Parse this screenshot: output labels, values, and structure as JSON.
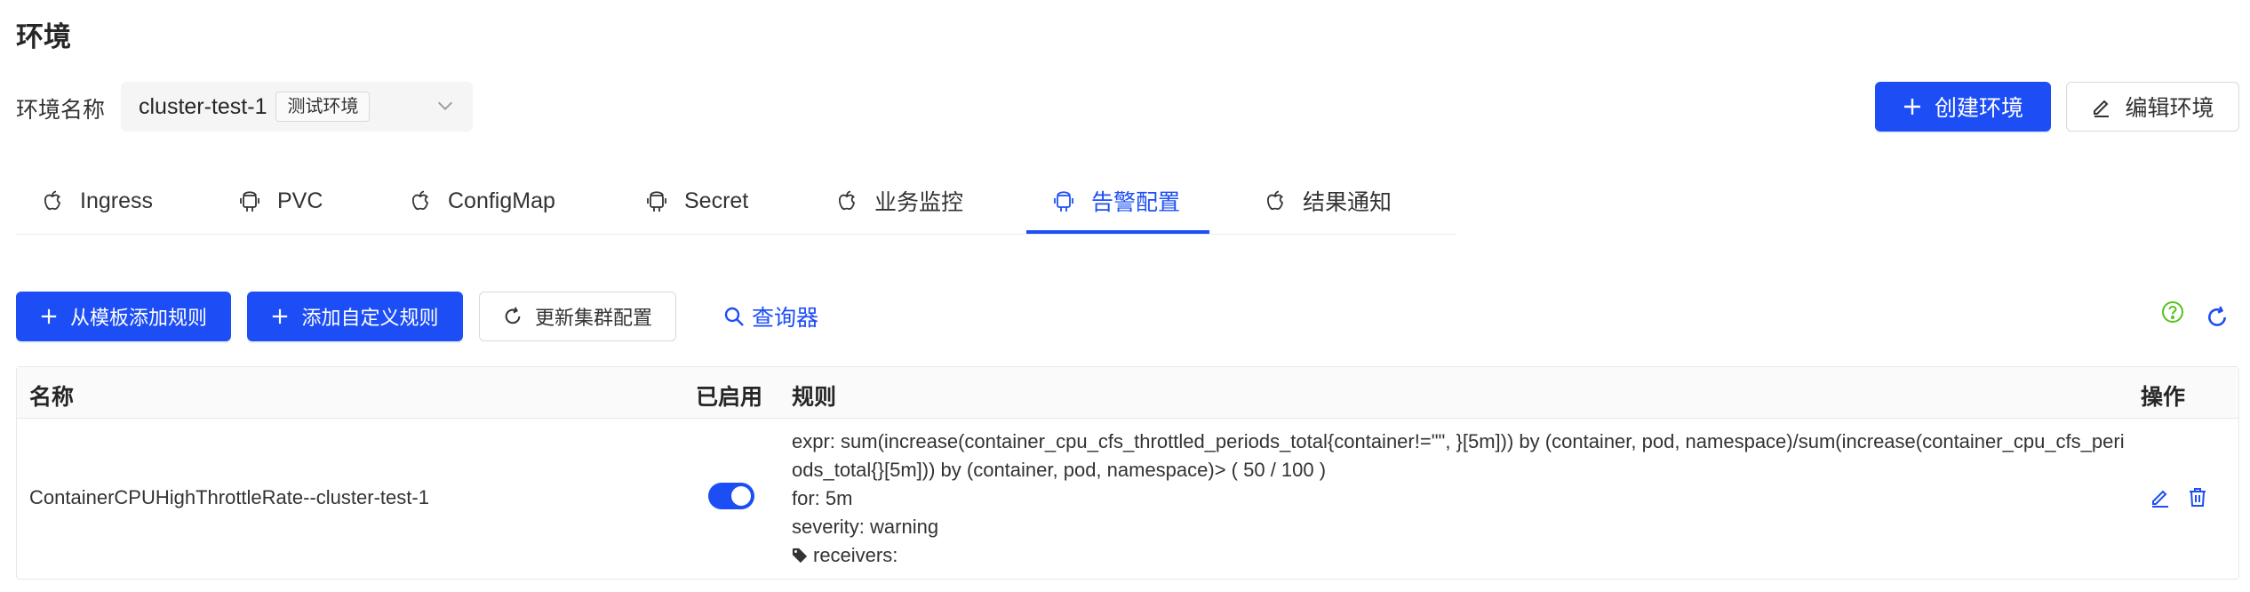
{
  "page": {
    "title": "环境"
  },
  "env": {
    "label": "环境名称",
    "value": "cluster-test-1",
    "tag": "测试环境"
  },
  "header_actions": {
    "create": "创建环境",
    "edit": "编辑环境"
  },
  "tabs": [
    {
      "label": "Ingress",
      "icon": "apple-icon"
    },
    {
      "label": "PVC",
      "icon": "android-icon"
    },
    {
      "label": "ConfigMap",
      "icon": "apple-icon"
    },
    {
      "label": "Secret",
      "icon": "android-icon"
    },
    {
      "label": "业务监控",
      "icon": "apple-icon"
    },
    {
      "label": "告警配置",
      "icon": "android-icon",
      "active": true
    },
    {
      "label": "结果通知",
      "icon": "apple-icon"
    }
  ],
  "toolbar": {
    "add_from_template": "从模板添加规则",
    "add_custom": "添加自定义规则",
    "update_cluster": "更新集群配置",
    "query": "查询器"
  },
  "table": {
    "headers": {
      "name": "名称",
      "enabled": "已启用",
      "rule": "规则",
      "ops": "操作"
    },
    "rows": [
      {
        "name": "ContainerCPUHighThrottleRate--cluster-test-1",
        "enabled": true,
        "expr": "expr: sum(increase(container_cpu_cfs_throttled_periods_total{container!=\"\", }[5m])) by (container, pod, namespace)/sum(increase(container_cpu_cfs_periods_total{}[5m])) by (container, pod, namespace)> ( 50 / 100 )",
        "for": "for: 5m",
        "severity": "severity: warning",
        "receivers": "receivers:"
      }
    ]
  },
  "colors": {
    "primary": "#1d4ef5",
    "help": "#52c41a"
  }
}
